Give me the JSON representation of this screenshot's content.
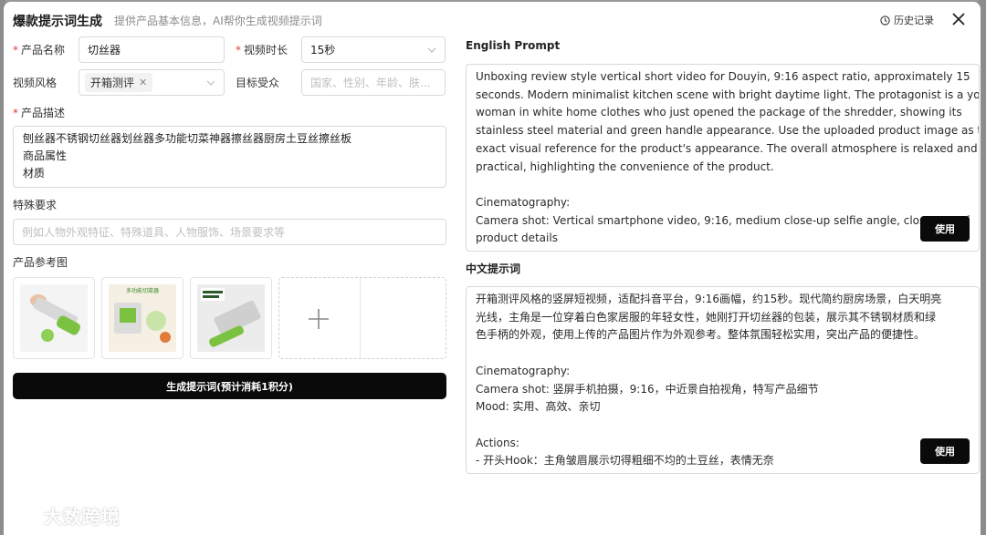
{
  "header": {
    "title": "爆款提示词生成",
    "subtitle": "提供产品基本信息，AI帮你生成视频提示词",
    "history_label": "历史记录"
  },
  "form": {
    "product_name": {
      "label": "产品名称",
      "value": "切丝器"
    },
    "video_duration": {
      "label": "视频时长",
      "value": "15秒"
    },
    "video_style": {
      "label": "视频风格",
      "tag": "开箱测评"
    },
    "target_audience": {
      "label": "目标受众",
      "placeholder": "国家、性别、年龄、肤..."
    },
    "product_desc": {
      "label": "产品描述",
      "lines": [
        "刨丝器不锈钢切丝器划丝器多功能切菜神器擦丝器厨房土豆丝擦丝板",
        "商品属性",
        "材质"
      ]
    },
    "special_req": {
      "label": "特殊要求",
      "placeholder": "例如人物外观特征、特殊道具、人物服饰、场景要求等"
    },
    "ref_images": {
      "label": "产品参考图",
      "thumb_text": "多功能切菜器"
    },
    "generate_label": "生成提示词(预计消耗1积分)"
  },
  "english": {
    "title": "English Prompt",
    "lines": [
      "Unboxing review style vertical short video for Douyin, 9:16 aspect ratio, approximately 15",
      "seconds. Modern minimalist kitchen scene with bright daytime light. The protagonist is a young",
      "woman in white home clothes who just opened the package of the shredder, showing its",
      "stainless steel material and green handle appearance. Use the uploaded product image as the",
      "exact visual reference for the product's appearance. The overall atmosphere is relaxed and",
      "practical, highlighting the convenience of the product.",
      "",
      "Cinematography:",
      "Camera shot: Vertical smartphone video, 9:16, medium close-up selfie angle, close-ups of",
      "product details"
    ],
    "use_label": "使用"
  },
  "chinese": {
    "title": "中文提示词",
    "lines": [
      "开箱测评风格的竖屏短视频，适配抖音平台，9:16画幅，约15秒。现代简约厨房场景，白天明亮",
      "光线，主角是一位穿着白色家居服的年轻女性，她刚打开切丝器的包装，展示其不锈钢材质和绿",
      "色手柄的外观，使用上传的产品图片作为外观参考。整体氛围轻松实用，突出产品的便捷性。",
      "",
      "Cinematography:",
      "Camera shot: 竖屏手机拍摄，9:16，中近景自拍视角，特写产品细节",
      "Mood: 实用、高效、亲切",
      "",
      "Actions:",
      "- 开头Hook：主角皱眉展示切得粗细不均的土豆丝，表情无奈"
    ],
    "use_label": "使用"
  },
  "watermark": {
    "text": "大数跨境"
  },
  "colors": {
    "accent": "#0a0a0a",
    "required": "#e23b3b",
    "border": "#d9d9d9",
    "product_green": "#7cc242"
  }
}
